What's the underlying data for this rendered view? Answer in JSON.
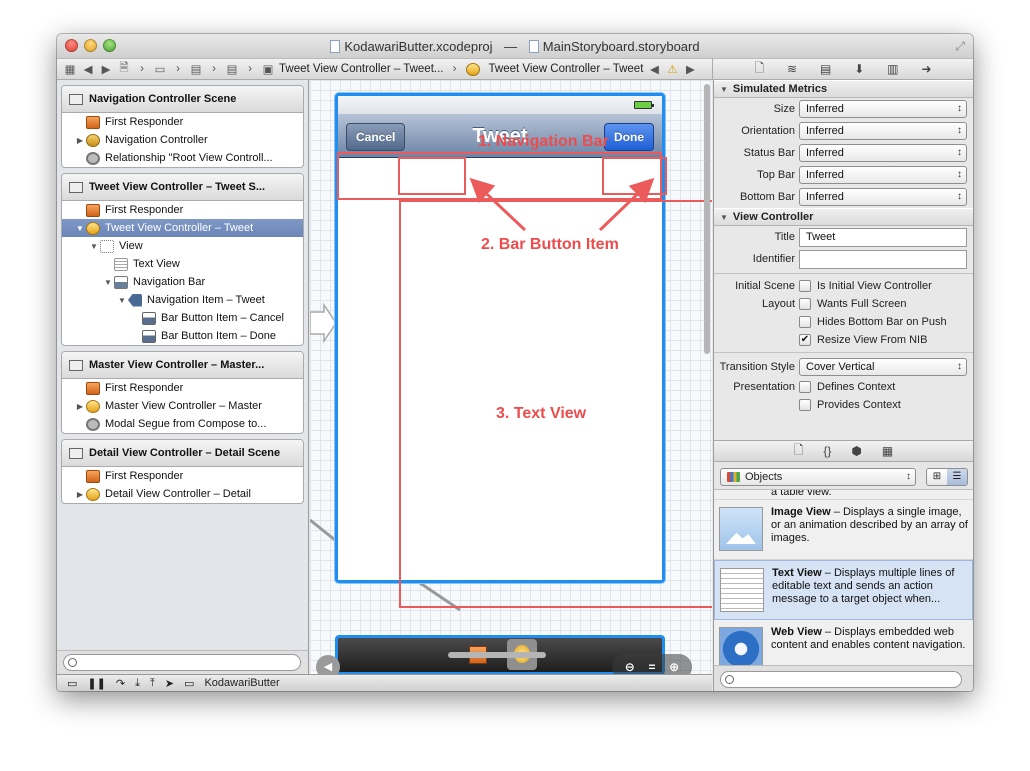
{
  "window": {
    "title_project": "KodawariButter.xcodeproj",
    "title_separator": "—",
    "title_storyboard": "MainStoryboard.storyboard"
  },
  "jumpbar": {
    "crumb_vc_scene": "Tweet View Controller – Tweet...",
    "crumb_vc": "Tweet View Controller – Tweet"
  },
  "outline": {
    "scenes": [
      {
        "title": "Navigation Controller Scene",
        "rows": [
          "First Responder",
          "Navigation Controller",
          "Relationship \"Root View Controll..."
        ]
      },
      {
        "title": "Tweet View Controller – Tweet S...",
        "rows": [
          "First Responder",
          "Tweet View Controller – Tweet",
          "View",
          "Text View",
          "Navigation Bar",
          "Navigation Item – Tweet",
          "Bar Button Item – Cancel",
          "Bar Button Item – Done"
        ]
      },
      {
        "title": "Master View Controller – Master...",
        "rows": [
          "First Responder",
          "Master View Controller – Master",
          "Modal Segue from Compose to..."
        ]
      },
      {
        "title": "Detail View Controller – Detail Scene",
        "rows": [
          "First Responder",
          "Detail View Controller – Detail"
        ]
      }
    ]
  },
  "debugbar": {
    "target": "KodawariButter"
  },
  "canvas": {
    "nav_title": "Tweet",
    "cancel_label": "Cancel",
    "done_label": "Done",
    "annotation_1": "1. Navigation Bar",
    "annotation_2": "2. Bar Button Item",
    "annotation_3": "3. Text View",
    "annotation_color": "#ec5b5b"
  },
  "inspector": {
    "simulated_metrics": {
      "header": "Simulated Metrics",
      "size_label": "Size",
      "size_value": "Inferred",
      "orientation_label": "Orientation",
      "orientation_value": "Inferred",
      "status_bar_label": "Status Bar",
      "status_bar_value": "Inferred",
      "top_bar_label": "Top Bar",
      "top_bar_value": "Inferred",
      "bottom_bar_label": "Bottom Bar",
      "bottom_bar_value": "Inferred"
    },
    "view_controller": {
      "header": "View Controller",
      "title_label": "Title",
      "title_value": "Tweet",
      "identifier_label": "Identifier",
      "identifier_value": "",
      "initial_scene_label": "Initial Scene",
      "initial_scene_text": "Is Initial View Controller",
      "layout_label": "Layout",
      "wants_full_screen": "Wants Full Screen",
      "hides_bottom_bar": "Hides Bottom Bar on Push",
      "resize_view": "Resize View From NIB",
      "transition_style_label": "Transition Style",
      "transition_style_value": "Cover Vertical",
      "presentation_label": "Presentation",
      "defines_context": "Defines Context",
      "provides_context": "Provides Context"
    }
  },
  "library": {
    "selector": "Objects",
    "partial_item": "a table view.",
    "items": [
      {
        "name": "Image View",
        "desc": " – Displays a single image, or an animation described by an array of images."
      },
      {
        "name": "Text View",
        "desc": " – Displays multiple lines of editable text and sends an action message to a target object when..."
      },
      {
        "name": "Web View",
        "desc": " – Displays embedded web content and enables content navigation."
      }
    ]
  }
}
